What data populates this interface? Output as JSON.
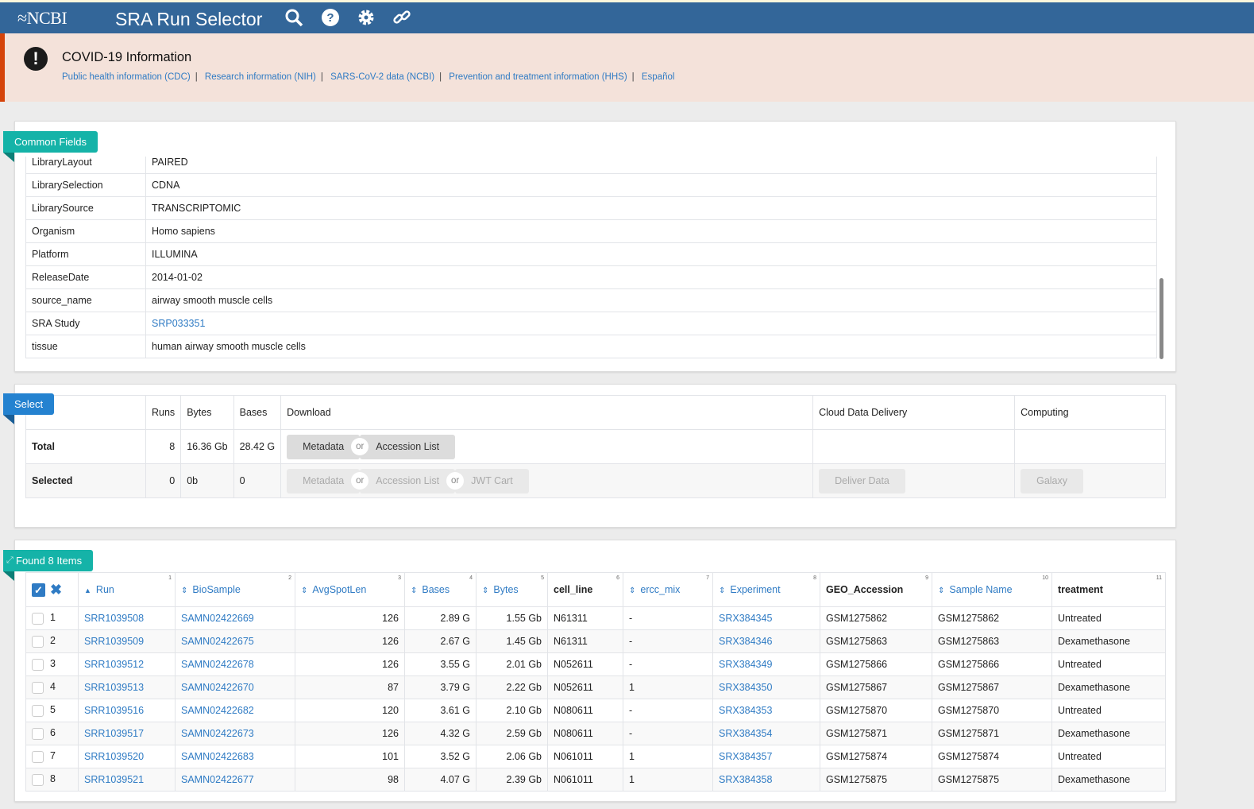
{
  "header": {
    "logo": "NCBI",
    "title": "SRA Run Selector",
    "icons": [
      "search-icon",
      "help-icon",
      "gear-icon",
      "link-icon"
    ]
  },
  "banner": {
    "title": "COVID-19 Information",
    "links": [
      "Public health information (CDC)",
      "Research information (NIH)",
      "SARS-CoV-2 data (NCBI)",
      "Prevention and treatment information (HHS)",
      "Español"
    ]
  },
  "colors": {
    "header": "#336699",
    "banner_bg": "#f4e2da",
    "banner_accent": "#d54309",
    "teal": "#15b3a8",
    "select_blue": "#2482d0",
    "link": "#2f7bc4"
  },
  "common_fields": {
    "tag": "Common Fields",
    "rows": [
      {
        "label": "LibraryLayout",
        "value": "PAIRED"
      },
      {
        "label": "LibrarySelection",
        "value": "CDNA"
      },
      {
        "label": "LibrarySource",
        "value": "TRANSCRIPTOMIC"
      },
      {
        "label": "Organism",
        "value": "Homo sapiens"
      },
      {
        "label": "Platform",
        "value": "ILLUMINA"
      },
      {
        "label": "ReleaseDate",
        "value": "2014-01-02"
      },
      {
        "label": "source_name",
        "value": "airway smooth muscle cells"
      },
      {
        "label": "SRA Study",
        "value": "SRP033351",
        "link": true
      },
      {
        "label": "tissue",
        "value": "human airway smooth muscle cells"
      }
    ]
  },
  "select": {
    "tag": "Select",
    "headers": [
      "Runs",
      "Bytes",
      "Bases",
      "Download",
      "Cloud Data Delivery",
      "Computing"
    ],
    "total": {
      "label": "Total",
      "runs": "8",
      "bytes": "16.36 Gb",
      "bases": "28.42 G",
      "metadata": "Metadata",
      "or": "or",
      "accession_list": "Accession List"
    },
    "selected": {
      "label": "Selected",
      "runs": "0",
      "bytes": "0b",
      "bases": "0",
      "metadata": "Metadata",
      "or": "or",
      "accession_list": "Accession List",
      "jwt_cart": "JWT Cart",
      "deliver": "Deliver Data",
      "galaxy": "Galaxy"
    }
  },
  "results": {
    "tag": "Found 8 Items",
    "columns": [
      {
        "label": "Run",
        "sort": "asc",
        "n": "1"
      },
      {
        "label": "BioSample",
        "sort": "both",
        "n": "2"
      },
      {
        "label": "AvgSpotLen",
        "sort": "both",
        "n": "3"
      },
      {
        "label": "Bases",
        "sort": "both",
        "n": "4"
      },
      {
        "label": "Bytes",
        "sort": "both",
        "n": "5"
      },
      {
        "label": "cell_line",
        "sort": "none",
        "n": "6"
      },
      {
        "label": "ercc_mix",
        "sort": "both",
        "n": "7"
      },
      {
        "label": "Experiment",
        "sort": "both",
        "n": "8"
      },
      {
        "label": "GEO_Accession",
        "sort": "none",
        "n": "9"
      },
      {
        "label": "Sample Name",
        "sort": "both",
        "n": "10"
      },
      {
        "label": "treatment",
        "sort": "none",
        "n": "11"
      }
    ],
    "rows": [
      [
        "1",
        "SRR1039508",
        "SAMN02422669",
        "126",
        "2.89 G",
        "1.55 Gb",
        "N61311",
        "-",
        "SRX384345",
        "GSM1275862",
        "GSM1275862",
        "Untreated"
      ],
      [
        "2",
        "SRR1039509",
        "SAMN02422675",
        "126",
        "2.67 G",
        "1.45 Gb",
        "N61311",
        "-",
        "SRX384346",
        "GSM1275863",
        "GSM1275863",
        "Dexamethasone"
      ],
      [
        "3",
        "SRR1039512",
        "SAMN02422678",
        "126",
        "3.55 G",
        "2.01 Gb",
        "N052611",
        "-",
        "SRX384349",
        "GSM1275866",
        "GSM1275866",
        "Untreated"
      ],
      [
        "4",
        "SRR1039513",
        "SAMN02422670",
        "87",
        "3.79 G",
        "2.22 Gb",
        "N052611",
        "1",
        "SRX384350",
        "GSM1275867",
        "GSM1275867",
        "Dexamethasone"
      ],
      [
        "5",
        "SRR1039516",
        "SAMN02422682",
        "120",
        "3.61 G",
        "2.10 Gb",
        "N080611",
        "-",
        "SRX384353",
        "GSM1275870",
        "GSM1275870",
        "Untreated"
      ],
      [
        "6",
        "SRR1039517",
        "SAMN02422673",
        "126",
        "4.32 G",
        "2.59 Gb",
        "N080611",
        "-",
        "SRX384354",
        "GSM1275871",
        "GSM1275871",
        "Dexamethasone"
      ],
      [
        "7",
        "SRR1039520",
        "SAMN02422683",
        "101",
        "3.52 G",
        "2.06 Gb",
        "N061011",
        "1",
        "SRX384357",
        "GSM1275874",
        "GSM1275874",
        "Untreated"
      ],
      [
        "8",
        "SRR1039521",
        "SAMN02422677",
        "98",
        "4.07 G",
        "2.39 Gb",
        "N061011",
        "1",
        "SRX384358",
        "GSM1275875",
        "GSM1275875",
        "Dexamethasone"
      ]
    ]
  }
}
